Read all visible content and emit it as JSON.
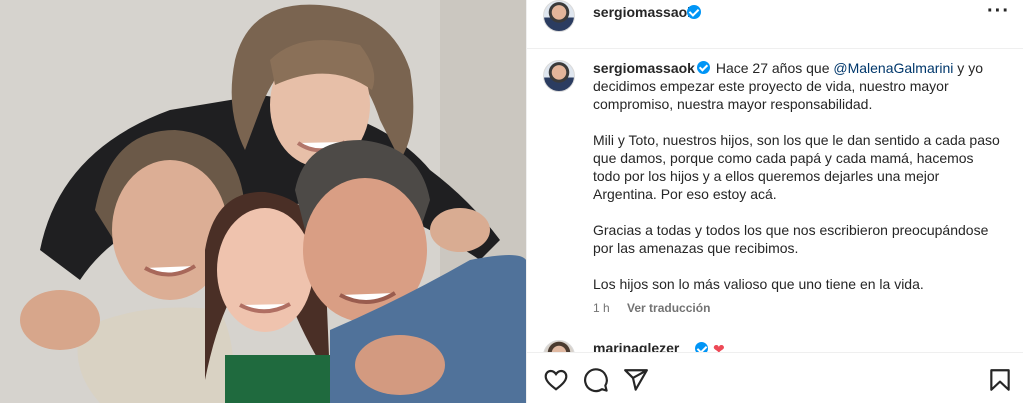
{
  "post": {
    "username": "sergiomassaok",
    "more_label": "···"
  },
  "caption": {
    "username": "sergiomassaok",
    "p1_before": "Hace 27 años que ",
    "mention": "@MalenaGalmarini",
    "p1_after": " y yo decidimos empezar este proyecto de vida, nuestro mayor compromiso, nuestra mayor responsabilidad.",
    "p2": "Mili y Toto, nuestros hijos, son los que le dan sentido a cada paso que damos, porque como cada papá y cada mamá, hacemos todo por los hijos y a ellos queremos dejarles una mejor Argentina. Por eso estoy acá.",
    "p3": "Gracias a todas y todos los que nos escribieron preocupándose por las amenazas que recibimos.",
    "p4": "Los hijos son lo más valioso que uno tiene en la vida."
  },
  "meta": {
    "time": "1 h",
    "translate": "Ver traducción"
  },
  "comment": {
    "username": "marinaglezer"
  },
  "icons": {
    "like": "heart-icon",
    "comment": "comment-icon",
    "share": "share-icon",
    "save": "bookmark-icon",
    "verified": "verified-badge-icon"
  },
  "colors": {
    "verified": "#0095f6",
    "mention": "#00376b",
    "heart": "#ed4956"
  }
}
